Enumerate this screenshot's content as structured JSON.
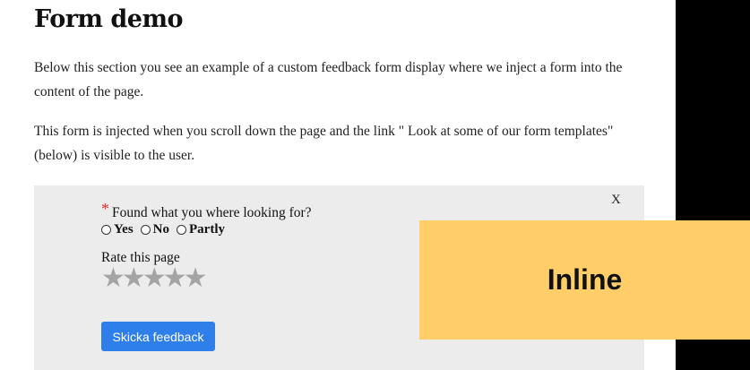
{
  "page": {
    "title": "Form demo",
    "paragraph1": "Below this section you see an example of a custom feedback form display where we inject a form into the content of the page.",
    "paragraph2": "This form is injected when you scroll down the page and the link \" Look at some of our form templates\" (below) is visible to the user."
  },
  "form": {
    "close_label": "X",
    "required_marker": "*",
    "question": "Found what you where looking for?",
    "options": [
      "Yes",
      "No",
      "Partly"
    ],
    "rating_label": "Rate this page",
    "rating_max": 5,
    "rating_value": 0,
    "submit_label": "Skicka feedback"
  },
  "overlay": {
    "label": "Inline"
  },
  "colors": {
    "form_background": "#ececec",
    "submit_button": "#2f7fea",
    "required_marker": "#e0302a",
    "star": "#a4a4a4",
    "overlay": "#ffce69"
  },
  "icons": {
    "radio": "radio-unchecked-icon",
    "star": "star-icon"
  }
}
